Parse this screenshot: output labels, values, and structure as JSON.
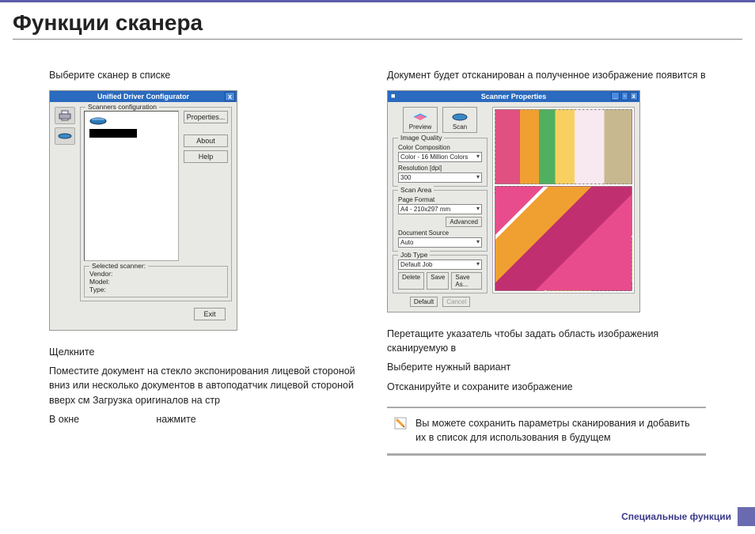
{
  "title": "Функции сканера",
  "left": {
    "p1": "Выберите сканер в списке",
    "p2": "Щелкните",
    "p3": "Поместите документ на стекло экспонирования лицевой стороной вниз или несколько документов в автоподатчик лицевой стороной вверх  см    Загрузка оригиналов   на стр",
    "p4a": "В окне",
    "p4b": "нажмите"
  },
  "right": {
    "p1": "Документ будет отсканирован  а полученное изображение появится в",
    "p2": "Перетащите указатель  чтобы задать область изображения сканируемую в",
    "p3": "Выберите нужный вариант",
    "p4": "Отсканируйте и сохраните изображение"
  },
  "udc": {
    "title": "Unified Driver Configurator",
    "close": "x",
    "legend1": "Scanners configuration",
    "properties": "Properties...",
    "about": "About",
    "help": "Help",
    "legend2": "Selected scanner:",
    "vendor": "Vendor:",
    "model": "Model:",
    "type": "Type:",
    "exit": "Exit"
  },
  "sp": {
    "title": "Scanner Properties",
    "preview": "Preview",
    "scan": "Scan",
    "legend_iq": "Image Quality",
    "color_comp_lbl": "Color Composition",
    "color_comp_val": "Color - 16 Million Colors",
    "res_lbl": "Resolution [dpi]",
    "res_val": "300",
    "legend_sa": "Scan Area",
    "page_format_lbl": "Page Format",
    "page_format_val": "A4 - 210x297 mm",
    "advanced": "Advanced",
    "docsrc_lbl": "Document Source",
    "docsrc_val": "Auto",
    "legend_jt": "Job Type",
    "default_job_val": "Default Job",
    "delete": "Delete",
    "save": "Save",
    "saveas": "Save As...",
    "default": "Default",
    "cancel": "Cancel"
  },
  "tip": "Вы можете сохранить параметры сканирования и добавить их в список                     для использования в будущем",
  "footer": "Специальные функции"
}
